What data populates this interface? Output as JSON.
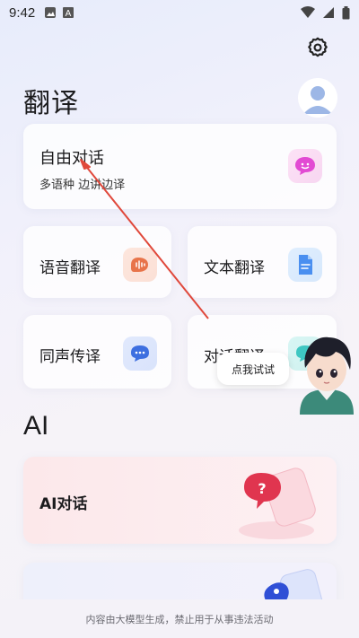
{
  "status_bar": {
    "time": "9:42"
  },
  "header": {
    "title": "翻译"
  },
  "cards": {
    "free_dialog": {
      "title": "自由对话",
      "subtitle": "多语种 边讲边译"
    },
    "voice": {
      "title": "语音翻译"
    },
    "text": {
      "title": "文本翻译"
    },
    "simul": {
      "title": "同声传译"
    },
    "dialog": {
      "title": "对话翻译"
    }
  },
  "ai_section": {
    "title": "AI",
    "ai_chat": {
      "title": "AI对话"
    }
  },
  "tooltip": {
    "text": "点我试试"
  },
  "footer": {
    "note": "内容由大模型生成，禁止用于从事违法活动"
  },
  "colors": {
    "accent_red": "#e0483b",
    "pink_icon": "#e24ad3",
    "orange_icon": "#e8744a",
    "blue_icon": "#3d6fe0",
    "teal_icon": "#3ec7c2"
  },
  "icons": [
    "image-icon",
    "a-icon",
    "wifi-icon",
    "signal-icon",
    "battery-icon",
    "gear-icon",
    "user-avatar-icon",
    "chat-bubble-pink-icon",
    "waveform-icon",
    "document-icon",
    "speech-bubble-blue-icon",
    "ai-chat-icon"
  ]
}
